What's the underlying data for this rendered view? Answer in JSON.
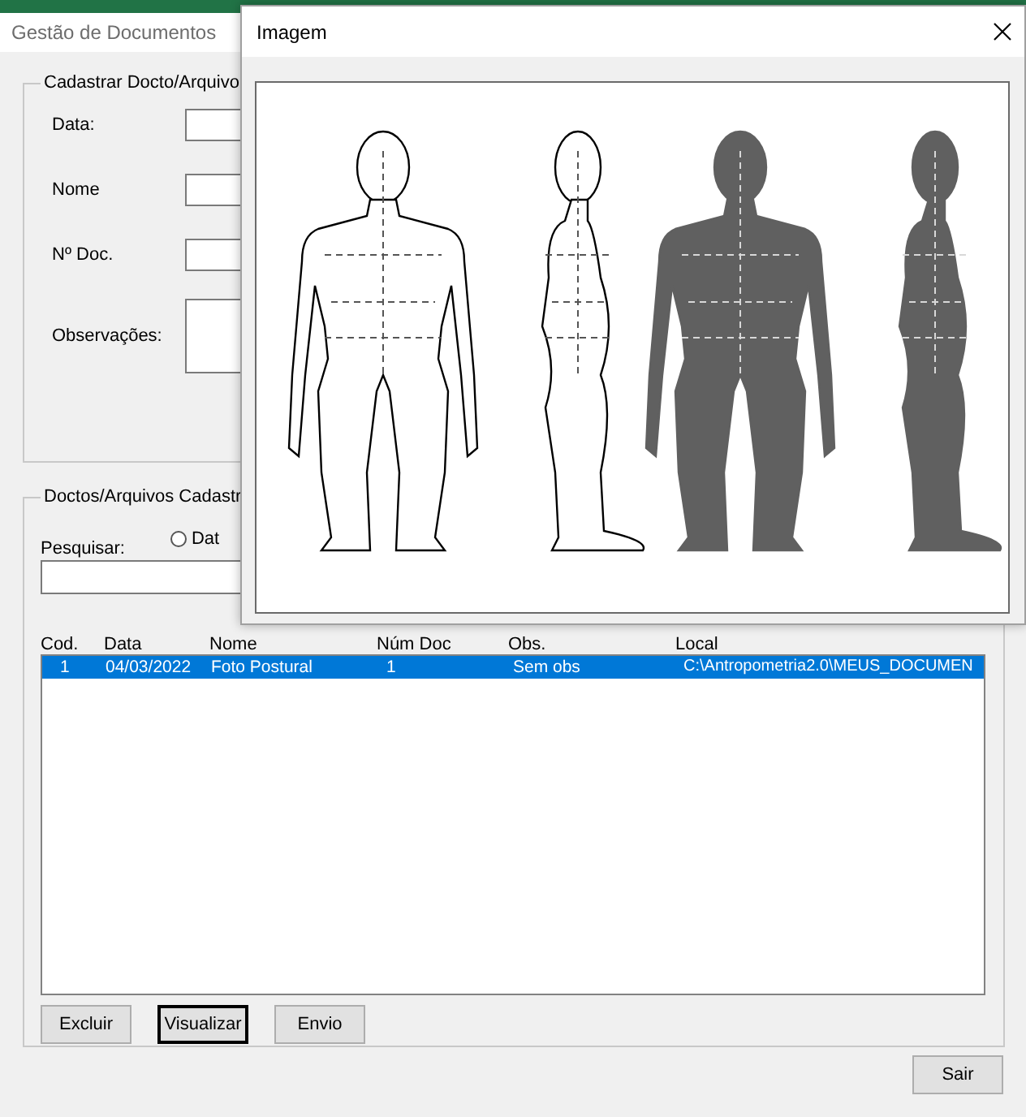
{
  "window": {
    "title": "Gestão de Documentos"
  },
  "register_frame": {
    "title": "Cadastrar Docto/Arquivo",
    "fields": [
      {
        "label": "Data:",
        "kind": "line"
      },
      {
        "label": "Nome",
        "kind": "line"
      },
      {
        "label": "Nº Doc.",
        "kind": "line"
      },
      {
        "label": "Observações:",
        "kind": "multiline"
      }
    ]
  },
  "list_frame": {
    "title": "Doctos/Arquivos Cadastr",
    "search_label": "Pesquisar:",
    "radio": {
      "label": "Dat",
      "selected": false
    },
    "columns": [
      "Cod.",
      "Data",
      "Nome",
      "Núm Doc",
      "Obs.",
      "Local"
    ],
    "rows": [
      {
        "cells": [
          "1",
          "04/03/2022",
          "Foto Postural",
          "1",
          "Sem obs",
          "C:\\Antropometria2.0\\MEUS_DOCUMEN"
        ],
        "selected": true
      }
    ],
    "buttons": [
      {
        "label": "Excluir",
        "default": false
      },
      {
        "label": "Visualizar",
        "default": true
      },
      {
        "label": "Envio",
        "default": false
      }
    ]
  },
  "exit_button": "Sair",
  "image_window": {
    "title": "Imagem"
  }
}
